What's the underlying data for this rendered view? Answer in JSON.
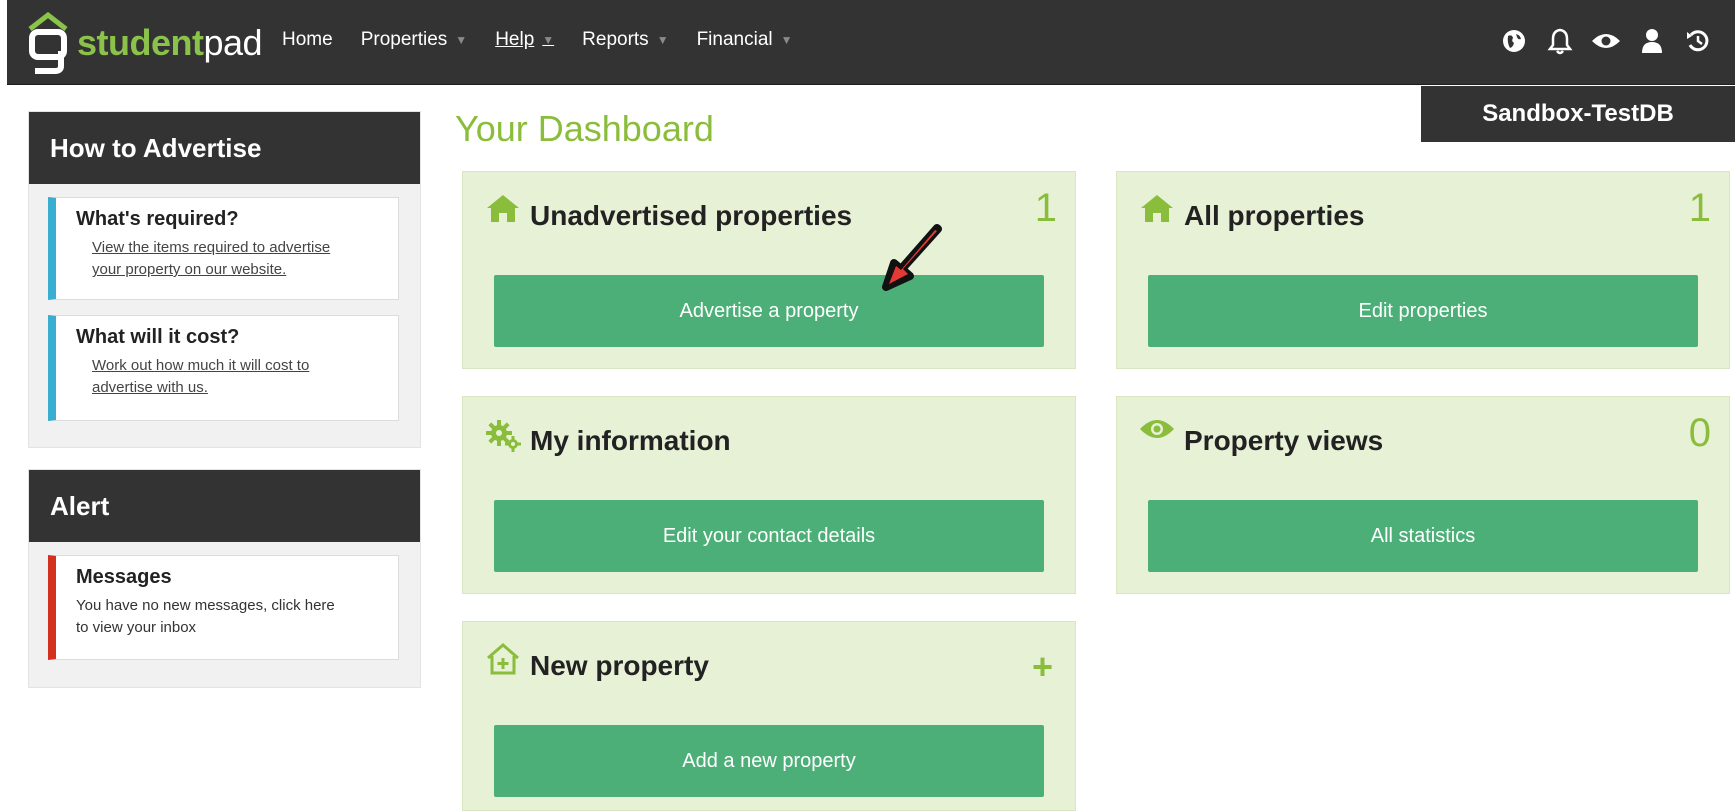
{
  "header": {
    "logo_text_green": "student",
    "logo_text_white": "pad",
    "nav": [
      {
        "label": "Home",
        "dropdown": false,
        "underlined": false
      },
      {
        "label": "Properties",
        "dropdown": true,
        "underlined": false
      },
      {
        "label": "Help",
        "dropdown": true,
        "underlined": true
      },
      {
        "label": "Reports",
        "dropdown": true,
        "underlined": false
      },
      {
        "label": "Financial",
        "dropdown": true,
        "underlined": false
      }
    ],
    "icons": [
      "globe-icon",
      "bell-icon",
      "eye-icon",
      "user-icon",
      "logout-icon"
    ],
    "database_label": "Sandbox-TestDB"
  },
  "sidebar": {
    "advertise_box": {
      "title": "How to Advertise",
      "cards": [
        {
          "title": "What's required?",
          "link_line1": "View the items required to advertise",
          "link_line2": "your property on our website."
        },
        {
          "title": "What will it cost?",
          "link_line1": "Work out how much it will cost to",
          "link_line2": "advertise with us."
        }
      ]
    },
    "alert_box": {
      "title": "Alert",
      "card": {
        "title": "Messages",
        "line1": "You have no new messages, click here",
        "line2": "to view your inbox"
      }
    }
  },
  "dashboard": {
    "title": "Your Dashboard",
    "cards": [
      {
        "icon": "house-icon",
        "title": "Unadvertised properties",
        "count": "1",
        "button": "Advertise a property"
      },
      {
        "icon": "house-icon",
        "title": "All properties",
        "count": "1",
        "button": "Edit properties"
      },
      {
        "icon": "gears-icon",
        "title": "My information",
        "count": "",
        "button": "Edit your contact details"
      },
      {
        "icon": "eye-icon",
        "title": "Property views",
        "count": "0",
        "button": "All statistics"
      },
      {
        "icon": "house-plus-icon",
        "title": "New property",
        "count": "+",
        "button": "Add a new property"
      }
    ]
  },
  "colors": {
    "topbar": "#333333",
    "accent_green": "#8bbd3c",
    "button_green": "#4caf78",
    "card_bg": "#e7f1d6",
    "blue_stripe": "#3aaed0",
    "red_stripe": "#d43020",
    "arrow_red": "#e53935"
  }
}
